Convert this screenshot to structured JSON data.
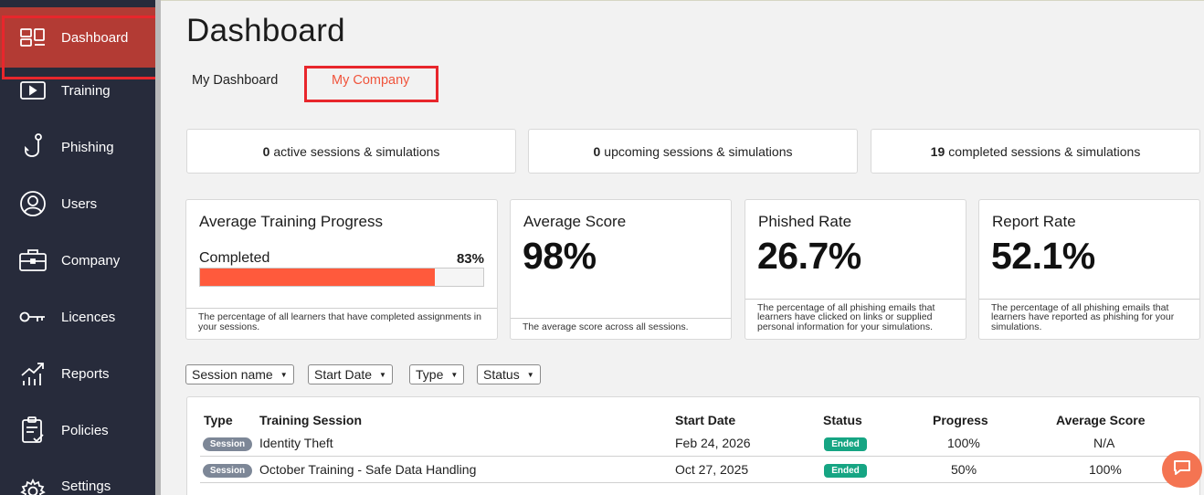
{
  "sidebar": {
    "items": [
      {
        "label": "Dashboard",
        "icon": "dashboard-icon",
        "active": true
      },
      {
        "label": "Training",
        "icon": "play-icon"
      },
      {
        "label": "Phishing",
        "icon": "hook-icon"
      },
      {
        "label": "Users",
        "icon": "user-icon"
      },
      {
        "label": "Company",
        "icon": "briefcase-icon"
      },
      {
        "label": "Licences",
        "icon": "key-icon"
      },
      {
        "label": "Reports",
        "icon": "chart-icon"
      },
      {
        "label": "Policies",
        "icon": "clipboard-icon"
      },
      {
        "label": "Settings",
        "icon": "gear-icon"
      }
    ]
  },
  "page": {
    "title": "Dashboard"
  },
  "tabs": {
    "my_dashboard": "My Dashboard",
    "my_company": "My Company",
    "active": "my_company"
  },
  "sessions": [
    {
      "count": "0",
      "text": "active sessions & simulations"
    },
    {
      "count": "0",
      "text": "upcoming sessions & simulations"
    },
    {
      "count": "19",
      "text": "completed sessions & simulations"
    }
  ],
  "cards": {
    "training": {
      "title": "Average Training Progress",
      "label": "Completed",
      "percent_text": "83%",
      "percent": 83,
      "footer": "The percentage of all learners that have completed assignments in your sessions."
    },
    "score": {
      "title": "Average Score",
      "value": "98%",
      "footer": "The average score across all sessions."
    },
    "phished": {
      "title": "Phished Rate",
      "value": "26.7%",
      "footer": "The percentage of all phishing emails that learners have clicked on links or supplied personal information for your simulations."
    },
    "report": {
      "title": "Report Rate",
      "value": "52.1%",
      "footer": "The percentage of all phishing emails that learners have reported as phishing for your simulations."
    }
  },
  "filters": [
    "Session name",
    "Start Date",
    "Type",
    "Status"
  ],
  "table": {
    "columns": [
      "Type",
      "Training Session",
      "Start Date",
      "Status",
      "Progress",
      "Average Score"
    ],
    "rows": [
      {
        "type": "Session",
        "name": "Identity Theft",
        "start": "Feb 24, 2026",
        "status": "Ended",
        "progress": "100%",
        "score": "N/A"
      },
      {
        "type": "Session",
        "name": "October Training - Safe Data Handling",
        "start": "Oct 27, 2025",
        "status": "Ended",
        "progress": "50%",
        "score": "100%"
      }
    ]
  },
  "colors": {
    "accent": "#f0543c",
    "sidebar": "#272b3b",
    "progress": "#ff5a3c",
    "status_ended": "#16a583",
    "badge": "#7d8797"
  }
}
